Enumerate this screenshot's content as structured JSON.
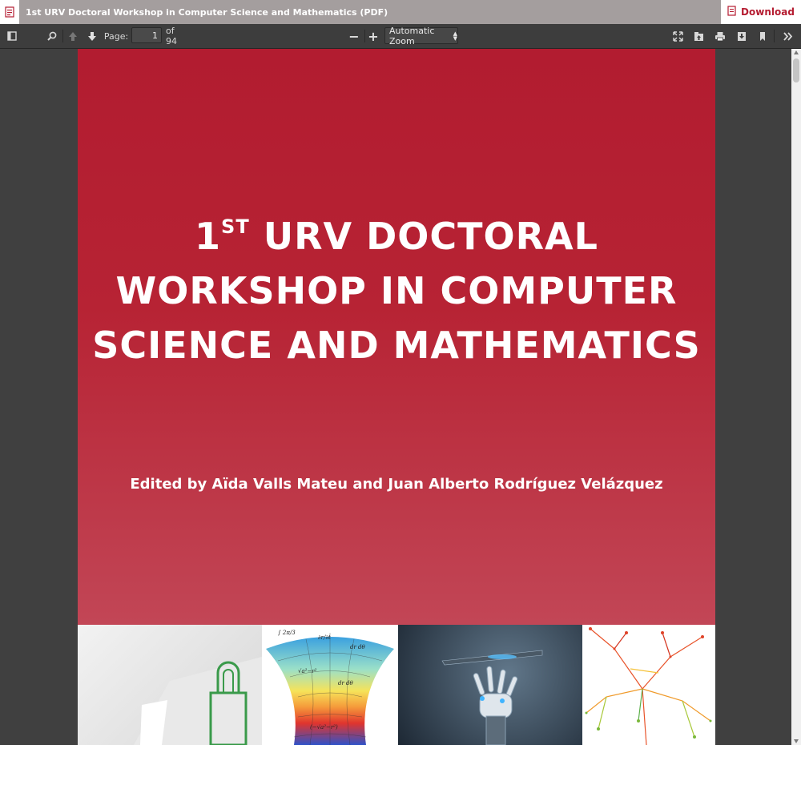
{
  "window": {
    "title": "1st URV Doctoral Workshop in Computer Science and Mathematics (PDF)",
    "download_label": "Download"
  },
  "toolbar": {
    "page_label": "Page:",
    "page_number": "1",
    "page_total": "of 94",
    "zoom_value": "Automatic Zoom",
    "zoom_out": "−",
    "zoom_in": "+"
  },
  "cover": {
    "title_number": "1",
    "title_suffix": "ST",
    "title_line1_rest": " URV DOCTORAL",
    "title_line2": "WORKSHOP IN COMPUTER",
    "title_line3": "SCIENCE AND MATHEMATICS",
    "editors": "Edited by Aïda Valls Mateu and Juan Alberto Rodríguez Velázquez"
  },
  "colors": {
    "accent": "#b51c31",
    "titlebar": "#a49e9e",
    "toolbar": "#3d3d3d",
    "viewer_bg": "#404040"
  },
  "icons": [
    "pdf-file-icon",
    "sidebar-toggle-icon",
    "search-icon",
    "arrow-up-icon",
    "arrow-down-icon",
    "fullscreen-icon",
    "open-file-icon",
    "print-icon",
    "save-icon",
    "bookmark-icon",
    "more-tools-icon"
  ]
}
